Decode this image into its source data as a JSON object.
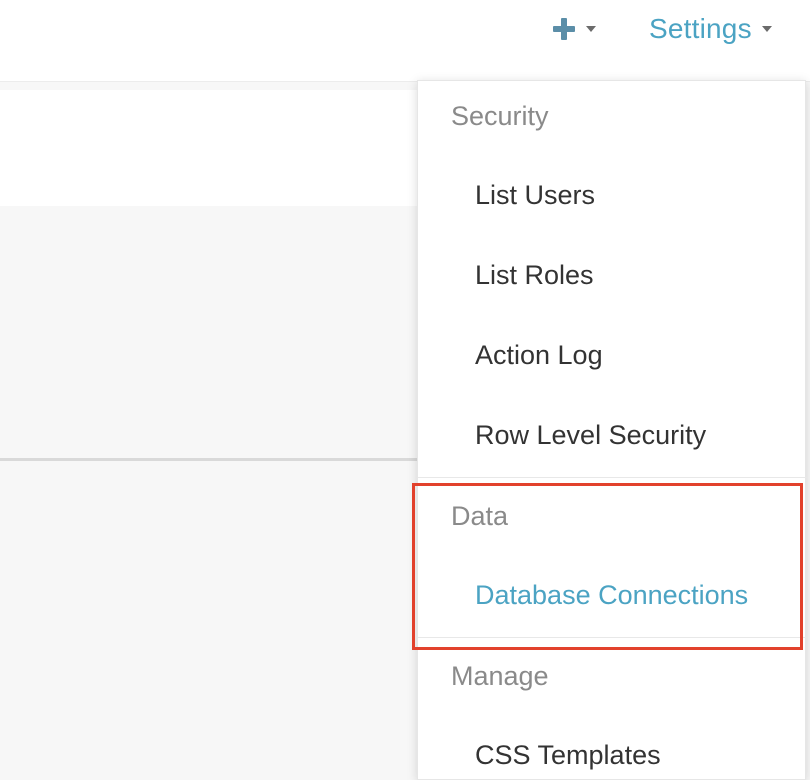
{
  "header": {
    "plus_icon": "plus-icon",
    "settings_label": "Settings"
  },
  "dropdown": {
    "groups": [
      {
        "label": "Security",
        "items": [
          {
            "label": "List Users"
          },
          {
            "label": "List Roles"
          },
          {
            "label": "Action Log"
          },
          {
            "label": "Row Level Security"
          }
        ]
      },
      {
        "label": "Data",
        "items": [
          {
            "label": "Database Connections",
            "active": true
          }
        ]
      },
      {
        "label": "Manage",
        "items": [
          {
            "label": "CSS Templates"
          }
        ]
      }
    ]
  },
  "colors": {
    "accent": "#4ba3c3",
    "highlight": "#e2412c",
    "plus_icon": "#5b8ea8"
  }
}
